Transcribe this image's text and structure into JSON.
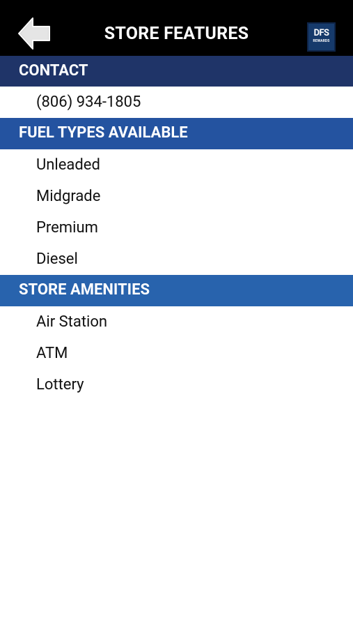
{
  "header": {
    "title": "STORE FEATURES",
    "back_icon": "back-arrow-icon",
    "logo": {
      "main": "DFS",
      "sub": "REWARDS"
    }
  },
  "sections": {
    "contact": {
      "title": "CONTACT",
      "items": [
        "(806) 934-1805"
      ]
    },
    "fuel_types": {
      "title": "FUEL TYPES AVAILABLE",
      "items": [
        "Unleaded",
        "Midgrade",
        "Premium",
        "Diesel"
      ]
    },
    "amenities": {
      "title": "STORE AMENITIES",
      "items": [
        "Air Station",
        "ATM",
        "Lottery"
      ]
    }
  },
  "colors": {
    "header_background": "#000000",
    "contact_header": "#1f3468",
    "fuel_header": "#2453a0",
    "amenities_header": "#2863ad",
    "logo_background": "#163a6b"
  }
}
